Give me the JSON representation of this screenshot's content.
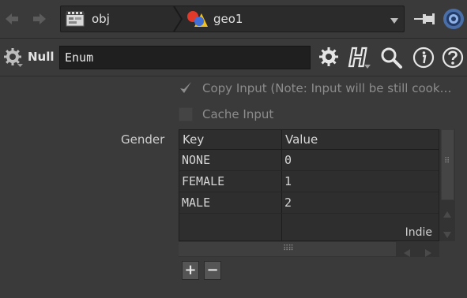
{
  "toolbar": {
    "back_icon": "back-arrow-icon",
    "forward_icon": "forward-arrow-icon",
    "path": [
      {
        "label": "obj",
        "icon": "obj-network-icon"
      },
      {
        "label": "geo1",
        "icon": "geo-node-icon"
      }
    ],
    "pin_icon": "pin-icon",
    "target_icon": "link-target-icon"
  },
  "node": {
    "type": "Null",
    "name": "Enum",
    "icons": [
      "gear-icon",
      "houdini-help-icon",
      "search-icon",
      "info-icon",
      "help-icon"
    ]
  },
  "params": {
    "copy_input": {
      "label": "Copy Input (Note: Input will be still cook…",
      "checked": true
    },
    "cache_input": {
      "label": "Cache Input",
      "checked": false
    },
    "gender": {
      "label": "Gender",
      "columns": [
        "Key",
        "Value"
      ],
      "rows": [
        {
          "key": "NONE",
          "value": "0"
        },
        {
          "key": "FEMALE",
          "value": "1"
        },
        {
          "key": "MALE",
          "value": "2"
        }
      ],
      "watermark": "Indie"
    },
    "add_label": "+",
    "remove_label": "−"
  },
  "colors": {
    "background": "#3a3a3a",
    "field": "#1f1f1f",
    "table": "#2e2e2e"
  }
}
